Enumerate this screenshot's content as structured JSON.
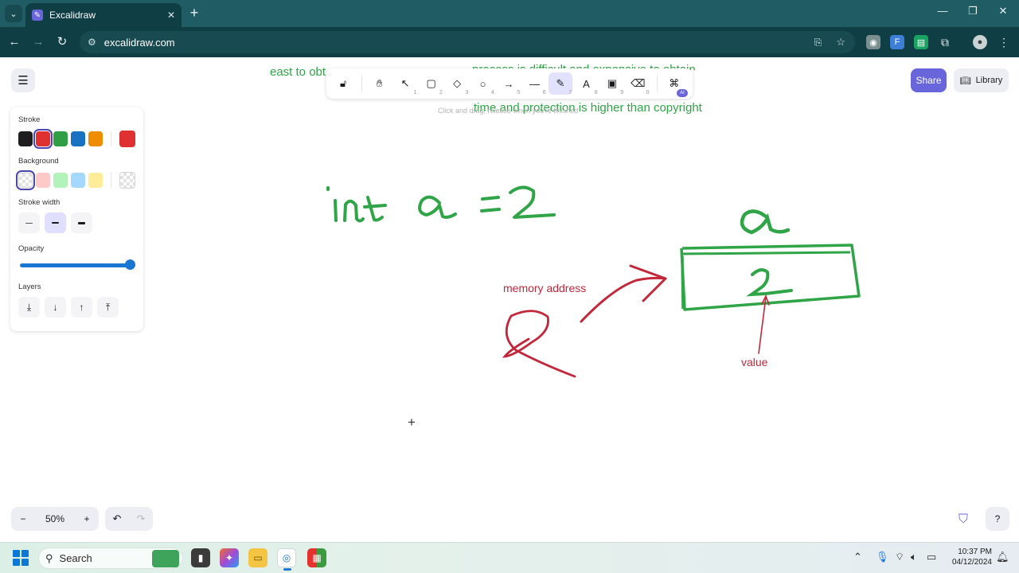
{
  "browser": {
    "tab_title": "Excalidraw",
    "tab_close": "✕",
    "new_tab": "+",
    "url": "excalidraw.com",
    "window_controls": [
      "—",
      "❐",
      "✕"
    ]
  },
  "toolbar": {
    "tools": [
      {
        "name": "lock-tool",
        "glyph": "🔓︎",
        "num": ""
      },
      {
        "name": "hand-tool",
        "glyph": "✋︎",
        "num": ""
      },
      {
        "name": "selection-tool",
        "glyph": "↖",
        "num": "1"
      },
      {
        "name": "rectangle-tool",
        "glyph": "▢",
        "num": "2"
      },
      {
        "name": "diamond-tool",
        "glyph": "◇",
        "num": "3"
      },
      {
        "name": "ellipse-tool",
        "glyph": "○",
        "num": "4"
      },
      {
        "name": "arrow-tool",
        "glyph": "→",
        "num": "5"
      },
      {
        "name": "line-tool",
        "glyph": "—",
        "num": "6"
      },
      {
        "name": "draw-tool",
        "glyph": "✎",
        "num": "7",
        "active": true
      },
      {
        "name": "text-tool",
        "glyph": "A",
        "num": "8"
      },
      {
        "name": "image-tool",
        "glyph": "▣",
        "num": "9"
      },
      {
        "name": "eraser-tool",
        "glyph": "⌫",
        "num": "0"
      }
    ],
    "extra_tools_badge": "AI",
    "hint": "Click and drag, release when you're finished"
  },
  "header": {
    "share_label": "Share",
    "library_label": "Library"
  },
  "properties": {
    "stroke_label": "Stroke",
    "stroke_colors": [
      "#1e1e1e",
      "#e03131",
      "#2f9e44",
      "#1971c2",
      "#f08c00"
    ],
    "stroke_selected_index": 1,
    "stroke_current": "#e03131",
    "background_label": "Background",
    "background_colors": [
      "transparent",
      "#ffc9c9",
      "#b2f2bb",
      "#a5d8ff",
      "#ffec99"
    ],
    "background_selected_index": 0,
    "stroke_width_label": "Stroke width",
    "stroke_width_selected_index": 1,
    "opacity_label": "Opacity",
    "opacity_value": 100,
    "layers_label": "Layers",
    "layer_glyphs": [
      "⤓",
      "↓",
      "↑",
      "⤒"
    ]
  },
  "footer": {
    "zoom_out": "−",
    "zoom_level": "50%",
    "zoom_in": "+",
    "undo": "↶",
    "redo": "↷",
    "help": "?"
  },
  "canvas_text": {
    "top_line_left": "east to obt",
    "top_line_right": "process is difficult and expensive to obtain",
    "second_line": "time and protection is higher than copyright",
    "memory_address": "memory address",
    "value": "value"
  },
  "taskbar": {
    "search_placeholder": "Search",
    "time": "10:37 PM",
    "date": "04/12/2024"
  },
  "colors": {
    "accent": "#6965db",
    "green_ink": "#2fa547",
    "red_ink": "#c3273a",
    "chrome_dark": "#0f3e45"
  }
}
